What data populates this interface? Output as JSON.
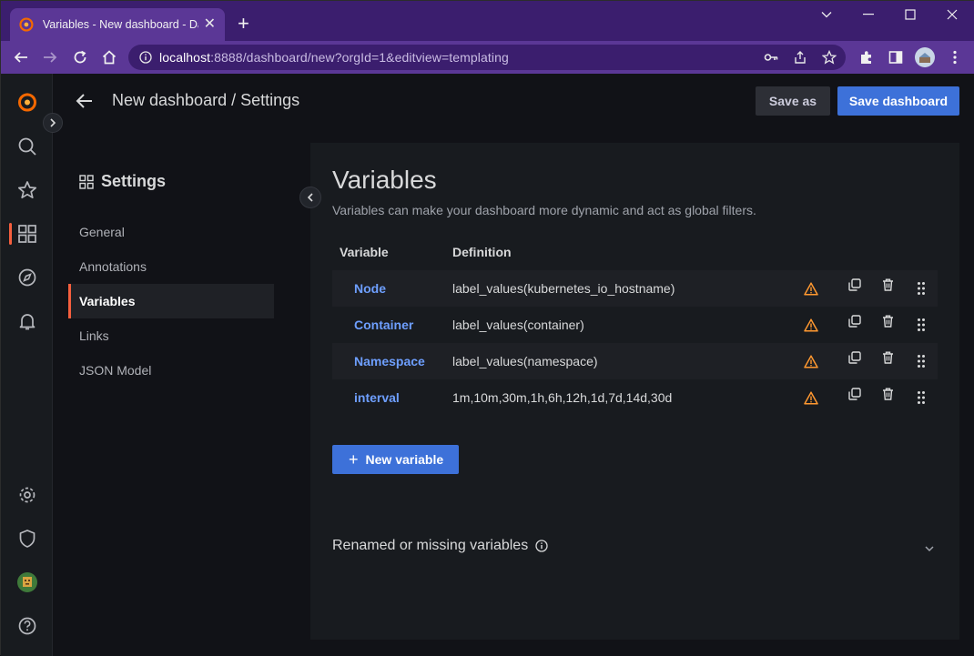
{
  "browser": {
    "tab_title": "Variables - New dashboard - Das",
    "new_tab": "+",
    "url_host": "localhost",
    "url_rest": ":8888/dashboard/new?orgId=1&editview=templating"
  },
  "header": {
    "title": "New dashboard / Settings",
    "save_as_label": "Save as",
    "save_dashboard_label": "Save dashboard"
  },
  "settings_nav": {
    "title": "Settings",
    "items": [
      {
        "label": "General"
      },
      {
        "label": "Annotations"
      },
      {
        "label": "Variables"
      },
      {
        "label": "Links"
      },
      {
        "label": "JSON Model"
      }
    ],
    "active": "Variables"
  },
  "variables": {
    "title": "Variables",
    "description": "Variables can make your dashboard more dynamic and act as global filters.",
    "columns": [
      "Variable",
      "Definition"
    ],
    "rows": [
      {
        "name": "Node",
        "definition": "label_values(kubernetes_io_hostname)"
      },
      {
        "name": "Container",
        "definition": "label_values(container)"
      },
      {
        "name": "Namespace",
        "definition": "label_values(namespace)"
      },
      {
        "name": "interval",
        "definition": "1m,10m,30m,1h,6h,12h,1d,7d,14d,30d"
      }
    ],
    "new_variable_label": "New variable",
    "renamed_missing_label": "Renamed or missing variables"
  },
  "colors": {
    "accent_orange": "#f55f3e",
    "primary_blue": "#3d71d9",
    "link_blue": "#6e9fff",
    "warning": "#ff9830",
    "browser_frame": "#3b1e6e"
  },
  "icons": {
    "sidemenu": [
      "grafana-logo-icon",
      "search-icon",
      "star-icon",
      "dashboards-icon",
      "explore-compass-icon",
      "alert-bell-icon",
      "gear-icon",
      "shield-icon",
      "user-avatar",
      "help-icon"
    ],
    "row_actions": [
      "warning-icon",
      "duplicate-icon",
      "trash-icon",
      "drag-handle-icon"
    ]
  }
}
